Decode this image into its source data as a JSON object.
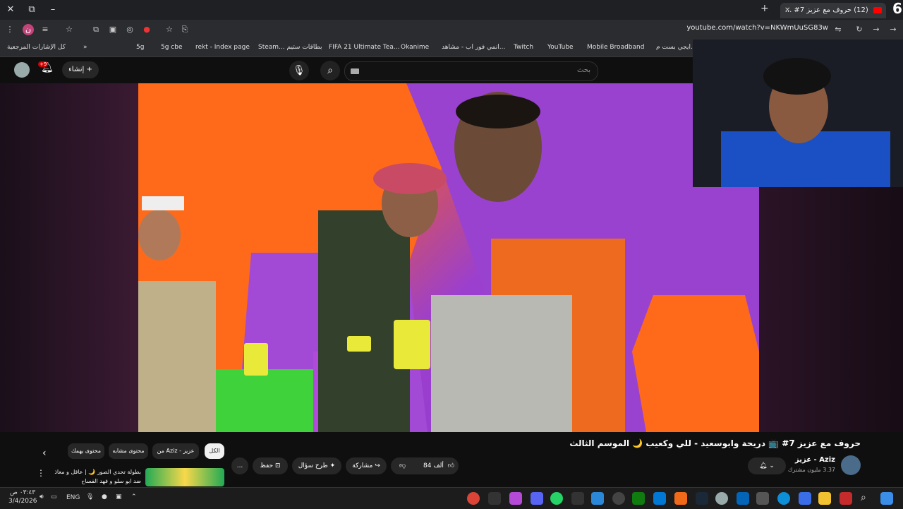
{
  "browser": {
    "tab_title": "(12) حروف مع عزيز 7# ...",
    "new_tab": "+",
    "corner_number": "6",
    "url": "youtube.com/watch?v=NKWmUuSG83w",
    "bookmarks": [
      "كل الإشارات المرجعية",
      "5g",
      "5g cbe",
      "rekt - Index page",
      "Steam... بطاقات ستيم",
      "FIFA 21 Ultimate Tea...",
      "Okanime",
      "انمي فور اب - مشاهد...",
      "Twitch",
      "YouTube",
      "Mobile Broadband",
      "ايجي بست م..."
    ]
  },
  "youtube_header": {
    "search_placeholder": "بحث",
    "create_label": "إنشاء",
    "notif_badge": "+9"
  },
  "video": {
    "title": "حروف مع عزيز 7# 📺 دريحة وابوسعيد - للي وكعيب 🌙 الموسم الثالث",
    "channel_name": "Aziz - عزيز",
    "channel_subs": "3.37 مليون مشترك",
    "likes": "84 ألف",
    "share_label": "مشاركة",
    "ask_label": "طرح سؤال",
    "save_label": "حفظ",
    "more_label": "..."
  },
  "chips": [
    "الكل",
    "من Aziz - عزيز",
    "محتوى مشابه",
    "محتوى يهمك"
  ],
  "up_next": {
    "text": "بطولة تحدي الصور 🌙 | عاقل و معاذ ضد ابو سلو و فهد الفساح"
  },
  "taskbar": {
    "time": "٠٣:٤٣ ص",
    "date": "3/4/2026",
    "lang": "ENG"
  },
  "colors": {
    "youtube_red": "#ff0000",
    "video_orange": "#ff6a1a",
    "video_purple": "#8d3bc8"
  }
}
